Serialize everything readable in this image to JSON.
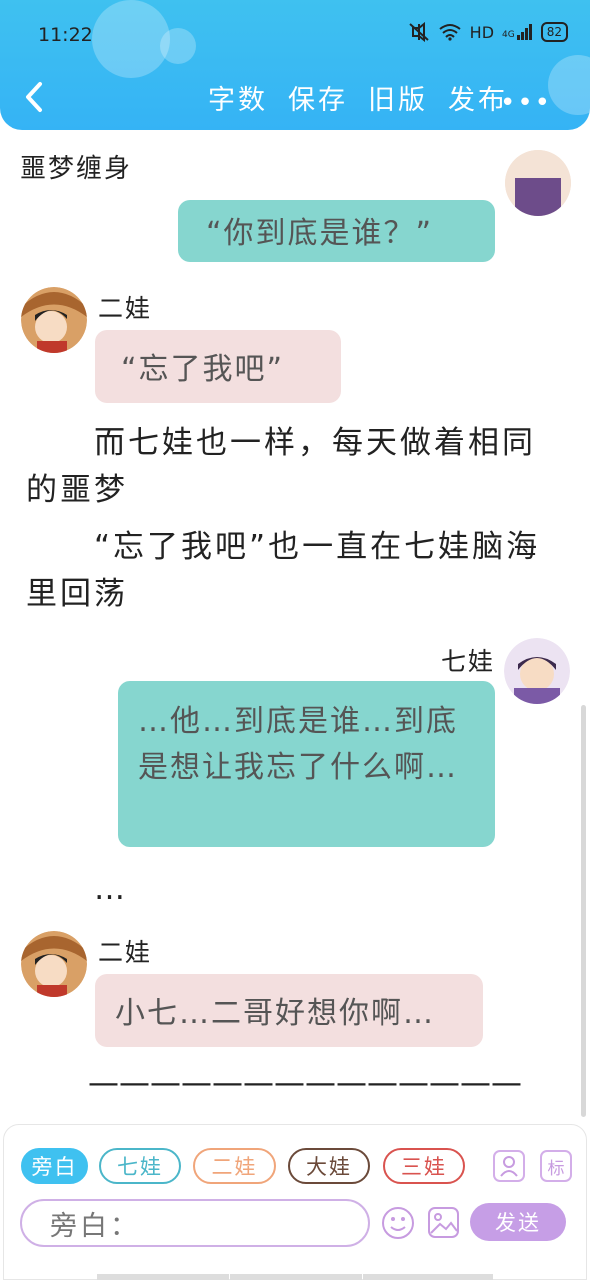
{
  "status_bar": {
    "time": "11:22",
    "network": "HD",
    "signal": "4G",
    "battery": "82"
  },
  "toolbar": {
    "items": [
      "字数",
      "保存",
      "旧版",
      "发布"
    ]
  },
  "story": {
    "title": "噩梦缠身"
  },
  "messages": {
    "m1": {
      "text": "“你到底是谁？”"
    },
    "m2": {
      "speaker": "二娃",
      "text": "“忘了我吧”"
    },
    "narr1": "　　而七娃也一样，每天做着相同的噩梦",
    "narr2": "　　“忘了我吧”也一直在七娃脑海里回荡",
    "m3": {
      "speaker": "七娃",
      "text": "…他…到底是谁…到底是想让我忘了什么啊…"
    },
    "narr3": "　　…",
    "m4": {
      "speaker": "二娃",
      "text": "小七…二哥好想你啊…"
    },
    "narr4": "　　——————————————"
  },
  "roles": [
    {
      "label": "旁白"
    },
    {
      "label": "七娃"
    },
    {
      "label": "二娃"
    },
    {
      "label": "大娃"
    },
    {
      "label": "三娃"
    }
  ],
  "side_buttons": {
    "mark_label": "标"
  },
  "input": {
    "placeholder": "旁白："
  },
  "send": {
    "label": "发送"
  },
  "colors": {
    "header": "#3fc1f0",
    "teal_bubble": "#86d6cf",
    "pink_bubble": "#f3dfdf",
    "chip_active": "#3fc1f0",
    "chip_qiwa": "#4bb6c9",
    "chip_erwa": "#f0a57a",
    "chip_dawa": "#6b4a3a",
    "chip_sanwa": "#d9534f",
    "send": "#c69ee6"
  }
}
